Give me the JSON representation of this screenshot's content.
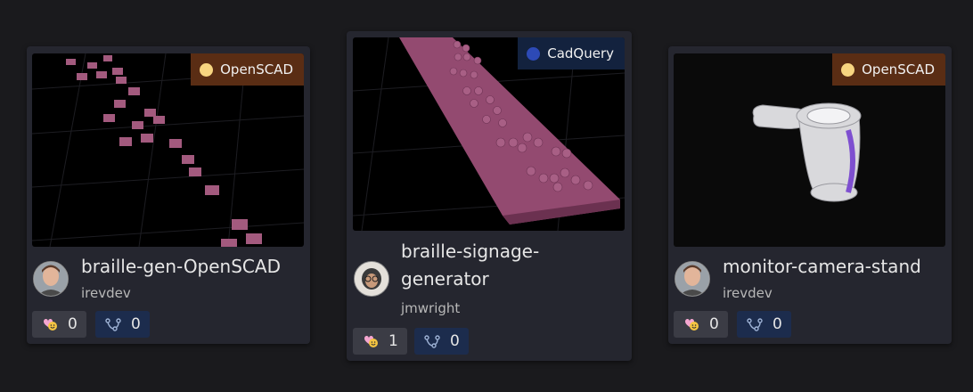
{
  "cards": [
    {
      "title": "braille-gen-OpenSCAD",
      "author": "irevdev",
      "language": {
        "label": "OpenSCAD",
        "dot_color": "#f7d580"
      },
      "likes": "0",
      "forks": "0"
    },
    {
      "title": "braille-signage-generator",
      "title_lines": [
        "braille-signage-",
        "generator"
      ],
      "author": "jmwright",
      "language": {
        "label": "CadQuery",
        "dot_color": "#2d4ab6"
      },
      "likes": "1",
      "forks": "0"
    },
    {
      "title": "monitor-camera-stand",
      "author": "irevdev",
      "language": {
        "label": "OpenSCAD",
        "dot_color": "#f7d580"
      },
      "likes": "0",
      "forks": "0"
    }
  ],
  "icons": {
    "like": "heart-smile-icon",
    "fork": "fork-icon"
  }
}
